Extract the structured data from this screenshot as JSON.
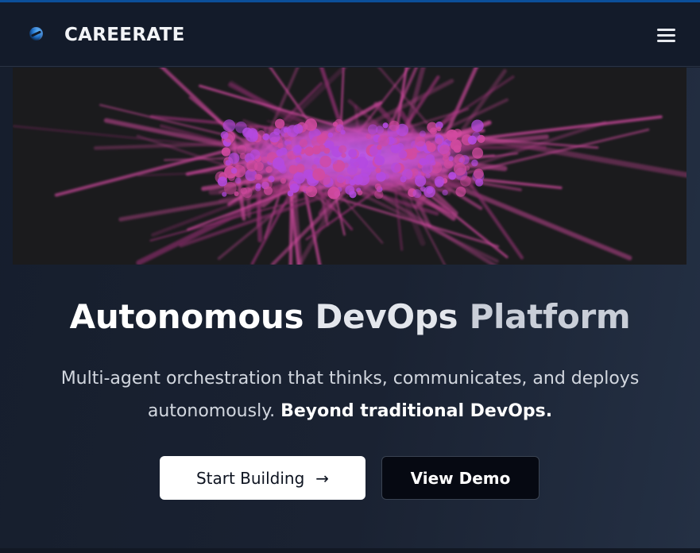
{
  "header": {
    "brand": "CAREERATE",
    "logo_icon": "globe-logo-icon",
    "menu_icon": "hamburger-menu-icon"
  },
  "hero": {
    "image_alt": "abstract-particle-burst",
    "headline_part1": "Autonomous ",
    "headline_part2": "DevOps ",
    "headline_part3": "Platform",
    "subtitle_line": "Multi-agent orchestration that thinks, communicates, and deploys autonomously.",
    "subtitle_bold": "Beyond traditional DevOps."
  },
  "actions": {
    "primary_label": "Start Building",
    "primary_icon": "arrow-right-icon",
    "primary_arrow": "→",
    "secondary_label": "View Demo"
  },
  "colors": {
    "accent_topline": "#0b4f9a",
    "navbar_bg": "#131b2a",
    "primary_btn_bg": "#ffffff",
    "secondary_btn_bg": "#060912",
    "image_pink": "#d24aa0",
    "image_violet": "#b44ae0"
  }
}
